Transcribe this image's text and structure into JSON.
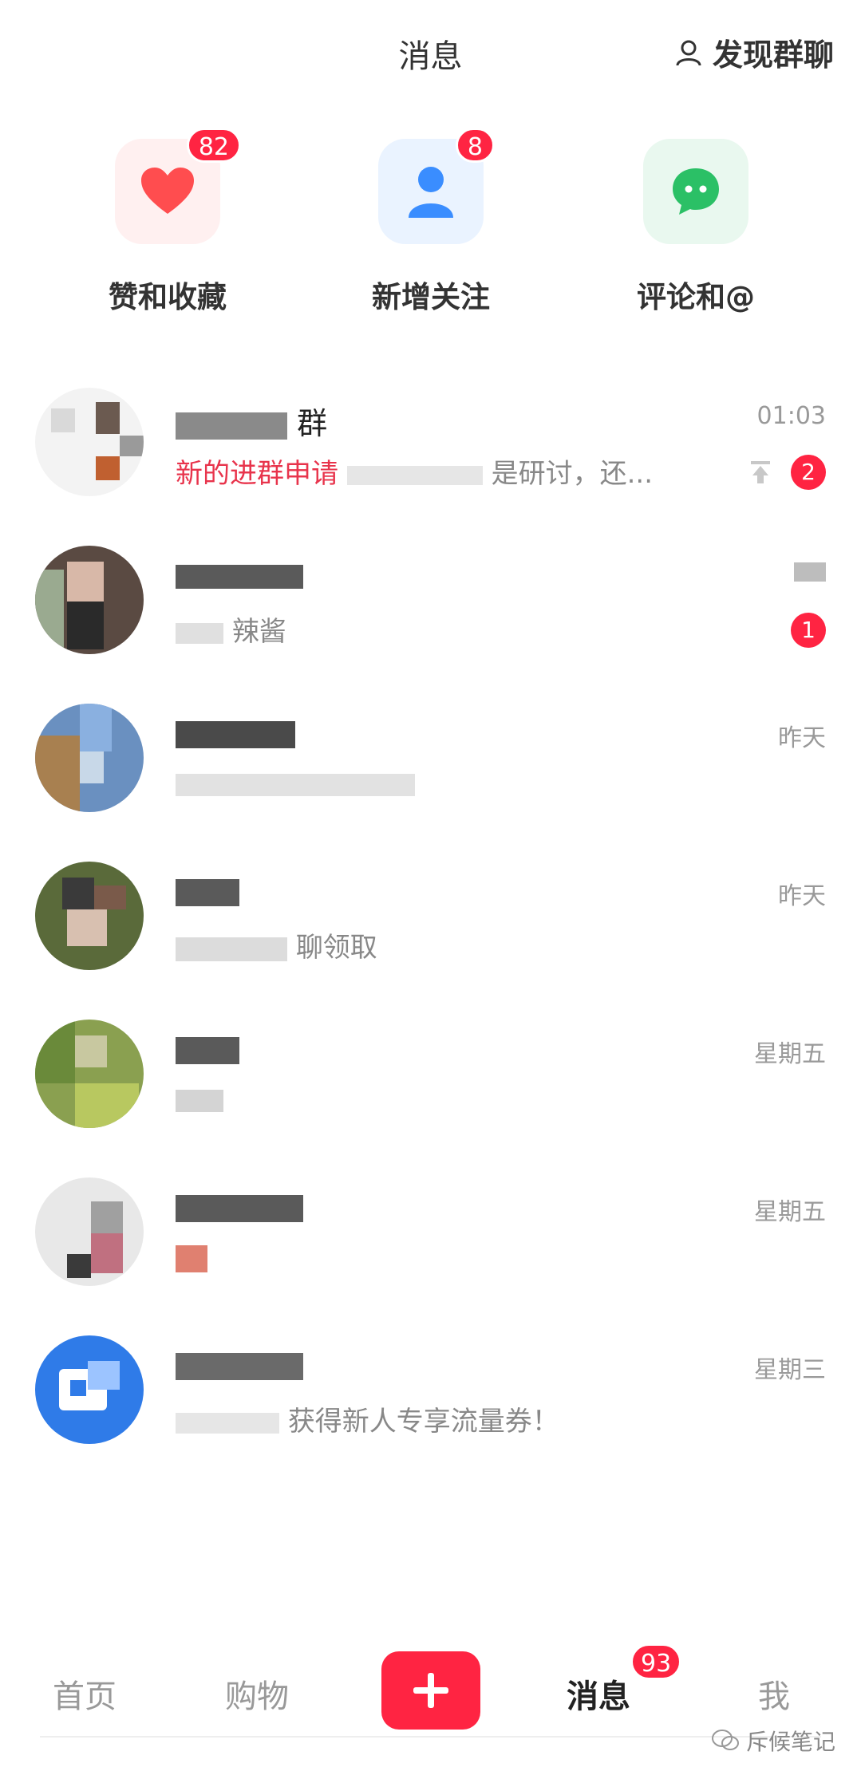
{
  "header": {
    "title": "消息",
    "discover_label": "发现群聊"
  },
  "shortcuts": [
    {
      "label": "赞和收藏",
      "badge": "82",
      "icon": "heart-icon",
      "color": "#ff4d4f",
      "bg": "#fff0f0"
    },
    {
      "label": "新增关注",
      "badge": "8",
      "icon": "person-icon",
      "color": "#3a8dff",
      "bg": "#eaf3ff"
    },
    {
      "label": "评论和@",
      "badge": "",
      "icon": "chat-bubble-icon",
      "color": "#2bc066",
      "bg": "#e9f8ef"
    }
  ],
  "conversations": [
    {
      "name": "群",
      "preview": "新的进群申请",
      "preview_tail": "是研讨，还...",
      "time": "01:03",
      "unread": "2",
      "pinned": true
    },
    {
      "name": "",
      "preview": "辣酱",
      "time": "",
      "unread": "1"
    },
    {
      "name": "",
      "preview": "",
      "time": "昨天",
      "unread": ""
    },
    {
      "name": "",
      "preview": "聊领取",
      "time": "昨天",
      "unread": ""
    },
    {
      "name": "",
      "preview": "",
      "time": "星期五",
      "unread": ""
    },
    {
      "name": "",
      "preview": "",
      "time": "星期五",
      "unread": ""
    },
    {
      "name": "",
      "preview": "获得新人专享流量券！",
      "time": "星期三",
      "unread": ""
    }
  ],
  "bottom_nav": {
    "home": "首页",
    "shop": "购物",
    "messages": "消息",
    "messages_badge": "93",
    "me": "我"
  },
  "watermark": "斥候笔记",
  "colors": {
    "accent": "#ff2442"
  }
}
